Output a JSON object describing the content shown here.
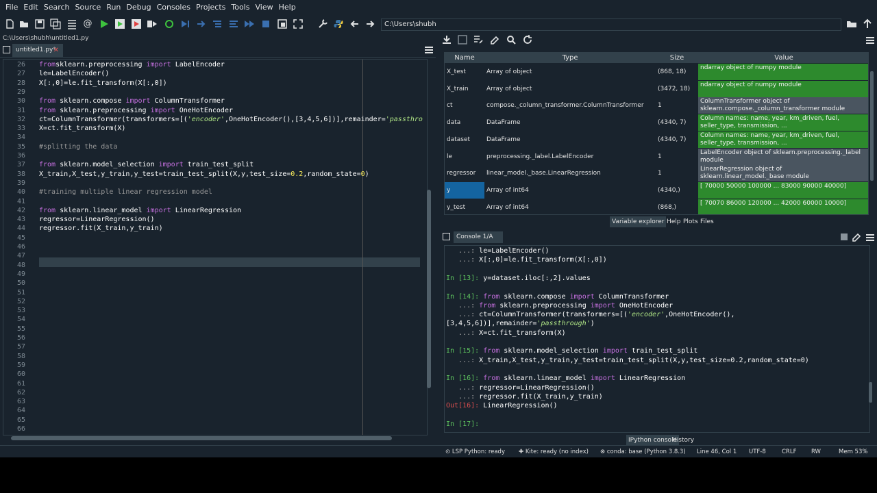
{
  "menu": [
    "File",
    "Edit",
    "Search",
    "Source",
    "Run",
    "Debug",
    "Consoles",
    "Projects",
    "Tools",
    "View",
    "Help"
  ],
  "toolbar": {
    "path": "C:\\Users\\shubh",
    "icons": [
      "new-file-icon",
      "open-folder-icon",
      "save-icon",
      "save-all-icon",
      "outline-icon",
      "email-icon",
      "run-icon",
      "run-cell-icon",
      "run-cell-advance-icon",
      "run-selection-icon",
      "rerun-icon",
      "debug-step-icon",
      "step-icon",
      "step-into-icon",
      "step-out-icon",
      "continue-icon",
      "stop-icon",
      "maximize-icon",
      "fullscreen-icon",
      "wrench-icon",
      "python-icon",
      "back-icon",
      "forward-icon"
    ]
  },
  "editor": {
    "file_path": "C:\\Users\\shubh\\untitled1.py",
    "tab_label": "untitled1.py*",
    "line_numbers": [
      "26",
      "27",
      "28",
      "29",
      "30",
      "31",
      "32",
      "33",
      "34",
      "35",
      "36",
      "37",
      "38",
      "39",
      "40",
      "41",
      "42",
      "43",
      "44",
      "45",
      "46",
      "47",
      "48",
      "49",
      "50",
      "51",
      "52",
      "53",
      "54",
      "55",
      "56",
      "57",
      "58",
      "59",
      "60",
      "61",
      "62",
      "63",
      "64",
      "65",
      "66"
    ],
    "lines": [
      {
        "parts": [
          [
            "kw",
            "from"
          ],
          [
            "",
            "sklearn.preprocessing "
          ],
          [
            "kw",
            "import"
          ],
          [
            "",
            " LabelEncoder"
          ]
        ]
      },
      {
        "parts": [
          [
            "",
            "le=LabelEncoder()"
          ]
        ]
      },
      {
        "parts": [
          [
            "",
            "X[:,0]=le.fit_transform(X[:,0])"
          ]
        ]
      },
      {
        "parts": []
      },
      {
        "parts": [
          [
            "kw",
            "from"
          ],
          [
            "",
            " sklearn.compose "
          ],
          [
            "kw",
            "import"
          ],
          [
            "",
            " ColumnTransformer"
          ]
        ]
      },
      {
        "parts": [
          [
            "kw",
            "from"
          ],
          [
            "",
            " sklearn.preprocessing "
          ],
          [
            "kw",
            "import"
          ],
          [
            "",
            " OneHotEncoder"
          ]
        ]
      },
      {
        "parts": [
          [
            "",
            "ct=ColumnTransformer(transformers=[("
          ],
          [
            "str",
            "'encoder'"
          ],
          [
            "",
            ",OneHotEncoder(),[3,4,5,6])],remainder="
          ],
          [
            "str",
            "'passthro"
          ]
        ]
      },
      {
        "parts": [
          [
            "",
            "X=ct.fit_transform(X)"
          ]
        ]
      },
      {
        "parts": []
      },
      {
        "parts": [
          [
            "cm",
            "#splitting the data"
          ]
        ]
      },
      {
        "parts": []
      },
      {
        "parts": [
          [
            "kw",
            "from"
          ],
          [
            "",
            " sklearn.model_selection "
          ],
          [
            "kw",
            "import"
          ],
          [
            "",
            " train_test_split"
          ]
        ]
      },
      {
        "parts": [
          [
            "",
            "X_train,X_test,y_train,y_test=train_test_split(X,y,test_size="
          ],
          [
            "num",
            "0.2"
          ],
          [
            "",
            ",random_state="
          ],
          [
            "num",
            "0"
          ],
          [
            "",
            ")"
          ]
        ]
      },
      {
        "parts": []
      },
      {
        "parts": [
          [
            "cm",
            "#training multiple linear regression model"
          ]
        ]
      },
      {
        "parts": []
      },
      {
        "parts": [
          [
            "kw",
            "from"
          ],
          [
            "",
            " sklearn.linear_model "
          ],
          [
            "kw",
            "import"
          ],
          [
            "",
            " LinearRegression"
          ]
        ]
      },
      {
        "parts": [
          [
            "",
            "regressor=LinearRegression()"
          ]
        ]
      },
      {
        "parts": [
          [
            "",
            "regressor.fit(X_train,y_train)"
          ]
        ]
      }
    ]
  },
  "variable_explorer": {
    "headers": {
      "name": "Name",
      "type": "Type",
      "size": "Size",
      "value": "Value"
    },
    "rows": [
      {
        "name": "X_test",
        "type": "Array of object",
        "size": "(868, 18)",
        "value": "ndarray object of numpy module",
        "color": "green"
      },
      {
        "name": "X_train",
        "type": "Array of object",
        "size": "(3472, 18)",
        "value": "ndarray object of numpy module",
        "color": "green"
      },
      {
        "name": "ct",
        "type": "compose._column_transformer.ColumnTransformer",
        "size": "1",
        "value": "ColumnTransformer object of sklearn.compose._column_transformer module",
        "color": "grey"
      },
      {
        "name": "data",
        "type": "DataFrame",
        "size": "(4340, 7)",
        "value": "Column names: name, year, km_driven, fuel, seller_type, transmission, ...",
        "color": "green"
      },
      {
        "name": "dataset",
        "type": "DataFrame",
        "size": "(4340, 7)",
        "value": "Column names: name, year, km_driven, fuel, seller_type, transmission, ...",
        "color": "green"
      },
      {
        "name": "le",
        "type": "preprocessing._label.LabelEncoder",
        "size": "1",
        "value": "LabelEncoder object of sklearn.preprocessing._label module",
        "color": "grey"
      },
      {
        "name": "regressor",
        "type": "linear_model._base.LinearRegression",
        "size": "1",
        "value": "LinearRegression object of sklearn.linear_model._base module",
        "color": "grey"
      },
      {
        "name": "y",
        "type": "Array of int64",
        "size": "(4340,)",
        "value": "[ 70000  50000 100000 ...  83000  90000 40000]",
        "color": "green"
      },
      {
        "name": "y_test",
        "type": "Array of int64",
        "size": "(868,)",
        "value": "[ 70070  86000 120000 ...  42000  60000 10000]",
        "color": "green"
      }
    ],
    "tabs": [
      "Variable explorer",
      "Help",
      "Plots",
      "Files"
    ]
  },
  "console": {
    "tab_label": "Console 1/A",
    "lines": [
      {
        "parts": [
          [
            "pcont",
            "   ...: "
          ],
          [
            "",
            "le=LabelEncoder()"
          ]
        ]
      },
      {
        "parts": [
          [
            "pcont",
            "   ...: "
          ],
          [
            "",
            "X[:,0]=le.fit_transform(X[:,0])"
          ]
        ]
      },
      {
        "parts": []
      },
      {
        "parts": [
          [
            "pin",
            "In [13]: "
          ],
          [
            "",
            "y=dataset.iloc[:,2].values"
          ]
        ]
      },
      {
        "parts": []
      },
      {
        "parts": [
          [
            "pin",
            "In [14]: "
          ],
          [
            "kw",
            "from"
          ],
          [
            "",
            " sklearn.compose "
          ],
          [
            "kw",
            "import"
          ],
          [
            "",
            " ColumnTransformer"
          ]
        ]
      },
      {
        "parts": [
          [
            "pcont",
            "   ...: "
          ],
          [
            "kw",
            "from"
          ],
          [
            "",
            " sklearn.preprocessing "
          ],
          [
            "kw",
            "import"
          ],
          [
            "",
            " OneHotEncoder"
          ]
        ]
      },
      {
        "parts": [
          [
            "pcont",
            "   ...: "
          ],
          [
            "",
            "ct=ColumnTransformer(transformers=[("
          ],
          [
            "str",
            "'encoder'"
          ],
          [
            "",
            ",OneHotEncoder(),"
          ]
        ]
      },
      {
        "parts": [
          [
            "",
            "[3,4,5,6])],remainder="
          ],
          [
            "str",
            "'passthrough'"
          ],
          [
            "",
            ")"
          ]
        ]
      },
      {
        "parts": [
          [
            "pcont",
            "   ...: "
          ],
          [
            "",
            "X=ct.fit_transform(X)"
          ]
        ]
      },
      {
        "parts": []
      },
      {
        "parts": [
          [
            "pin",
            "In [15]: "
          ],
          [
            "kw",
            "from"
          ],
          [
            "",
            " sklearn.model_selection "
          ],
          [
            "kw",
            "import"
          ],
          [
            "",
            " train_test_split"
          ]
        ]
      },
      {
        "parts": [
          [
            "pcont",
            "   ...: "
          ],
          [
            "",
            "X_train,X_test,y_train,y_test=train_test_split(X,y,test_size=0.2,random_state=0)"
          ]
        ]
      },
      {
        "parts": []
      },
      {
        "parts": [
          [
            "pin",
            "In [16]: "
          ],
          [
            "kw",
            "from"
          ],
          [
            "",
            " sklearn.linear_model "
          ],
          [
            "kw",
            "import"
          ],
          [
            "",
            " LinearRegression"
          ]
        ]
      },
      {
        "parts": [
          [
            "pcont",
            "   ...: "
          ],
          [
            "",
            "regressor=LinearRegression()"
          ]
        ]
      },
      {
        "parts": [
          [
            "pcont",
            "   ...: "
          ],
          [
            "",
            "regressor.fit(X_train,y_train)"
          ]
        ]
      },
      {
        "parts": [
          [
            "pout",
            "Out[16]: "
          ],
          [
            "",
            "LinearRegression()"
          ]
        ]
      },
      {
        "parts": []
      },
      {
        "parts": [
          [
            "pin",
            "In [17]: "
          ]
        ]
      }
    ],
    "tabs": [
      "IPython console",
      "History"
    ]
  },
  "status": {
    "lsp": "LSP Python: ready",
    "kite": "Kite: ready (no index)",
    "conda": "conda: base (Python 3.8.3)",
    "position": "Line 46, Col 1",
    "encoding": "UTF-8",
    "eol": "CRLF",
    "rw": "RW",
    "mem": "Mem 53%"
  },
  "colors": {
    "background": "#19232d",
    "green_cell": "#2d8a2d",
    "selection": "#1464a0",
    "keyword": "#c670e0",
    "string": "#b0e686"
  }
}
